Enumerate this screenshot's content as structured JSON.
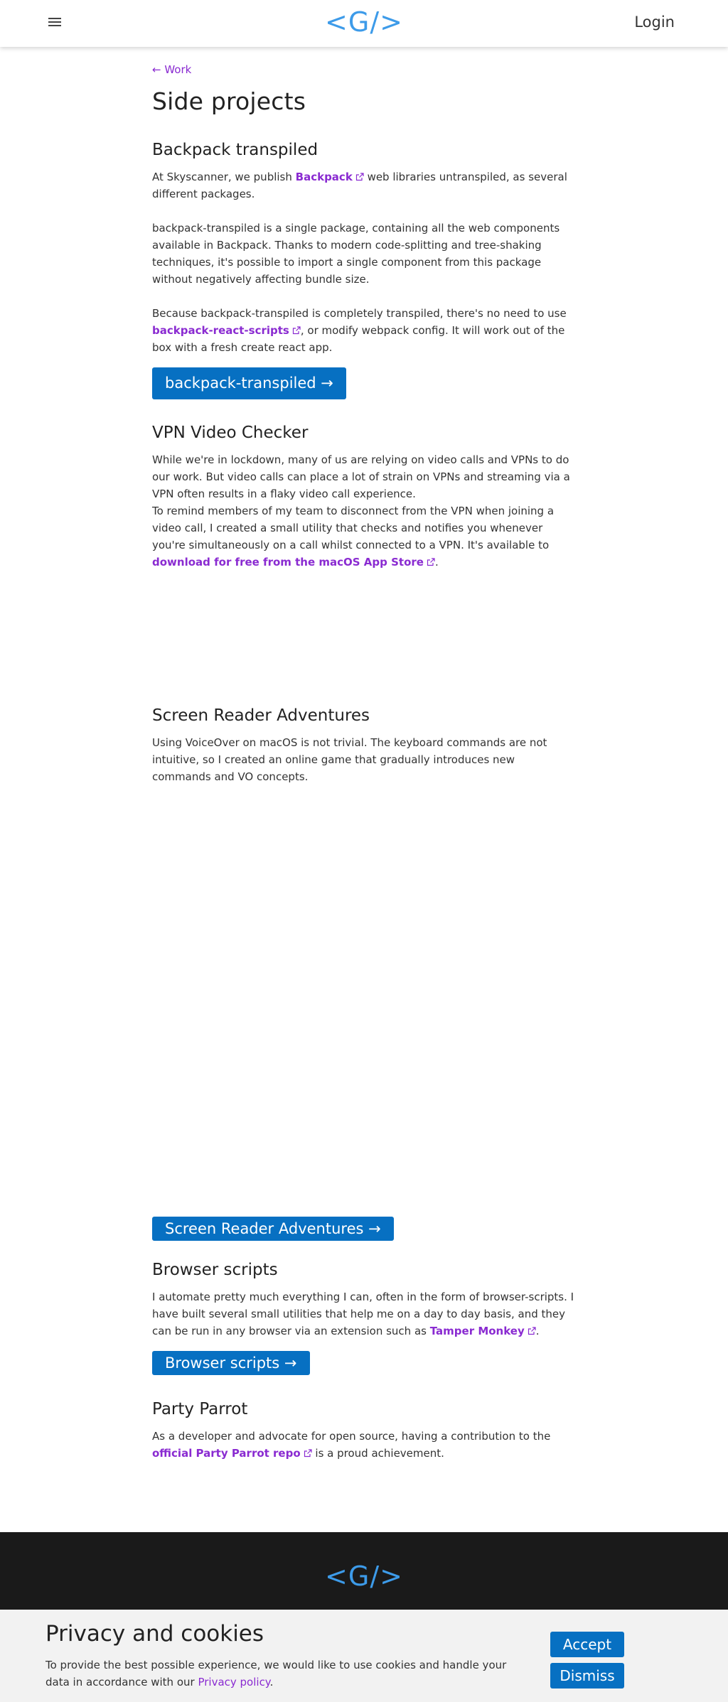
{
  "header": {
    "logo": "<G/>",
    "login_label": "Login"
  },
  "nav": {
    "back_label": "← Work"
  },
  "page": {
    "title": "Side projects"
  },
  "sections": {
    "backpack": {
      "title": "Backpack transpiled",
      "p1_before": "At Skyscanner, we publish ",
      "p1_link": "Backpack",
      "p1_after": " web libraries untranspiled, as several different packages.",
      "p2": "backpack-transpiled is a single package, containing all the web components available in Backpack. Thanks to modern code-splitting and tree-shaking techniques, it's possible to import a single component from this package without negatively affecting bundle size.",
      "p3_before": "Because backpack-transpiled is completely transpiled, there's no need to use ",
      "p3_link": "backpack-react-scripts",
      "p3_after": ", or modify webpack config. It will work out of the box with a fresh create react app.",
      "cta": "backpack-transpiled →"
    },
    "vpn": {
      "title": "VPN Video Checker",
      "p1": "While we're in lockdown, many of us are relying on video calls and VPNs to do our work. But video calls can place a lot of strain on VPNs and streaming via a VPN often results in a flaky video call experience.",
      "p2_before": "To remind members of my team to disconnect from the VPN when joining a video call, I created a small utility that checks and notifies you whenever you're simultaneously on a call whilst connected to a VPN. It's available to ",
      "p2_link": "download for free from the macOS App Store",
      "p2_after": "."
    },
    "screenreader": {
      "title": "Screen Reader Adventures",
      "p1": "Using VoiceOver on macOS is not trivial. The keyboard commands are not intuitive, so I created an online game that gradually introduces new commands and VO concepts.",
      "cta": "Screen Reader Adventures →"
    },
    "browser": {
      "title": "Browser scripts",
      "p1_before": "I automate pretty much everything I can, often in the form of browser-scripts. I have built several small utilities that help me on a day to day basis, and they can be run in any browser via an extension such as ",
      "p1_link": "Tamper Monkey",
      "p1_after": ".",
      "cta": "Browser scripts →"
    },
    "parrot": {
      "title": "Party Parrot",
      "p1_before": "As a developer and advocate for open source, having a contribution to the ",
      "p1_link": "official Party Parrot repo",
      "p1_after": " is a proud achievement."
    }
  },
  "footer": {
    "logo": "<G/>"
  },
  "cookie": {
    "title": "Privacy and cookies",
    "text_before": "To provide the best possible experience, we would like to use cookies and handle your data in accordance with our ",
    "link": "Privacy policy",
    "text_after": ".",
    "accept": "Accept",
    "dismiss": "Dismiss"
  },
  "colors": {
    "accent_link": "#8a2bd1",
    "button_blue": "#0770c2",
    "logo_blue": "#3d9be9",
    "footer_bg": "#1a1a1a"
  },
  "icons": [
    "menu-icon",
    "external-link-icon"
  ]
}
